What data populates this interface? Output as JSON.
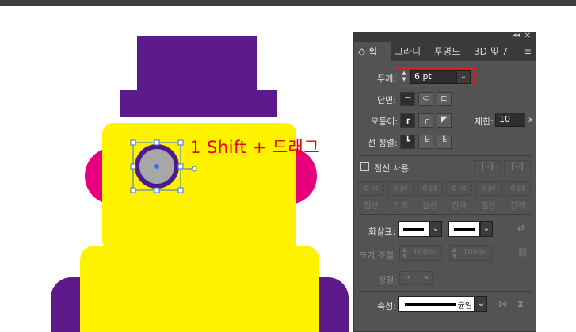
{
  "colors": {
    "hat": "#5c1a8a",
    "face": "#fff200",
    "ears": "#e6007e",
    "eye_fill": "#a7a7a7",
    "eye_ring": "#4b1a8c",
    "selection": "#3b6fe0",
    "annotation": "#e8000b",
    "highlight": "#e51c23",
    "panel_bg": "#535353"
  },
  "annotation": {
    "text": "1 Shift + 드래그"
  },
  "panel": {
    "title_icons": {
      "collapse": "collapse-icon",
      "close": "close-icon"
    },
    "tabs": [
      {
        "label": "획",
        "prefix": "◇ "
      },
      {
        "label": "그라디"
      },
      {
        "label": "투명도"
      },
      {
        "label": "3D 및 7"
      }
    ],
    "menu_icon": "menu-icon",
    "weight": {
      "label": "두께:",
      "value": "6 pt"
    },
    "cap": {
      "label": "단면:"
    },
    "corner": {
      "label": "모퉁이:"
    },
    "limit": {
      "label": "제한:",
      "value": "10",
      "suffix": "x"
    },
    "align": {
      "label": "선 정렬:"
    },
    "dashed": {
      "label": "점선 사용",
      "fields": [
        {
          "value": "0 pt",
          "label": "점선"
        },
        {
          "value": "0 pt",
          "label": "간격"
        },
        {
          "value": "0 pt",
          "label": "점선"
        },
        {
          "value": "0 pt",
          "label": "간격"
        },
        {
          "value": "0 pt",
          "label": "점선"
        },
        {
          "value": "0 pt",
          "label": "간격"
        }
      ]
    },
    "arrowheads": {
      "label": "화살표:"
    },
    "scale": {
      "label": "크기 조절:",
      "values": [
        "100%",
        "100%"
      ]
    },
    "align_arrows": {
      "label": "정렬:"
    },
    "profile": {
      "label": "속성:",
      "value": "균일"
    }
  }
}
